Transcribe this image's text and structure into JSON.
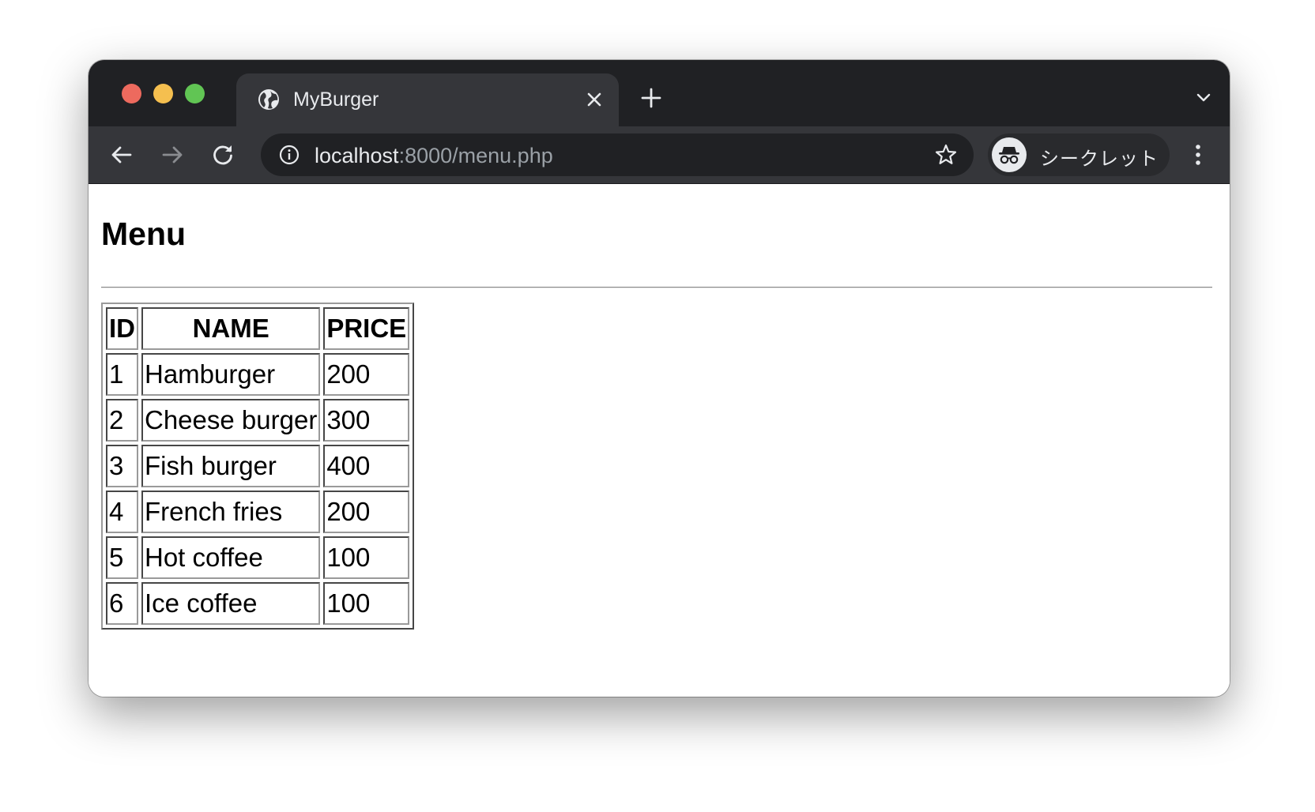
{
  "browser": {
    "tab_title": "MyBurger",
    "url_host": "localhost",
    "url_rest": ":8000/menu.php",
    "incognito_label": "シークレット"
  },
  "page": {
    "title": "Menu",
    "table": {
      "headers": [
        "ID",
        "NAME",
        "PRICE"
      ],
      "rows": [
        [
          "1",
          "Hamburger",
          "200"
        ],
        [
          "2",
          "Cheese burger",
          "300"
        ],
        [
          "3",
          "Fish burger",
          "400"
        ],
        [
          "4",
          "French fries",
          "200"
        ],
        [
          "5",
          "Hot coffee",
          "100"
        ],
        [
          "6",
          "Ice coffee",
          "100"
        ]
      ]
    }
  },
  "icons": {
    "traffic_lights": [
      "close-dot",
      "minimize-dot",
      "zoom-dot"
    ],
    "tab_favicon": "globe-icon",
    "tab_close": "close-icon",
    "new_tab": "plus-icon",
    "tab_search": "chevron-down-icon",
    "back": "arrow-left-icon",
    "forward": "arrow-right-icon",
    "reload": "reload-icon",
    "site_info": "info-icon",
    "bookmark": "star-icon",
    "incognito": "incognito-icon",
    "menu": "kebab-menu-icon"
  },
  "colors": {
    "tab_strip": "#202124",
    "toolbar": "#35363a",
    "close_dot": "#ed6a5e",
    "minimize_dot": "#f5bf4f",
    "zoom_dot": "#61c554"
  }
}
